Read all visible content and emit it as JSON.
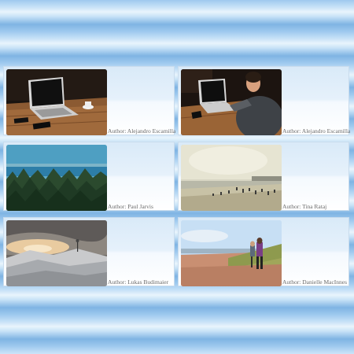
{
  "gallery": {
    "items": [
      {
        "author": "Author: Alejandro Escamilla",
        "image": "laptop-on-desk-photo"
      },
      {
        "author": "Author: Alejandro Escamilla",
        "image": "person-typing-laptop-photo"
      },
      {
        "author": "Author: Paul Jarvis",
        "image": "forest-lake-photo"
      },
      {
        "author": "Author: Tina Rataj",
        "image": "beach-crowd-photo"
      },
      {
        "author": "Author: Lukas Budimaier",
        "image": "snowy-sunset-photo"
      },
      {
        "author": "Author: Danielle MacInnes",
        "image": "couple-on-beach-photo"
      }
    ]
  }
}
